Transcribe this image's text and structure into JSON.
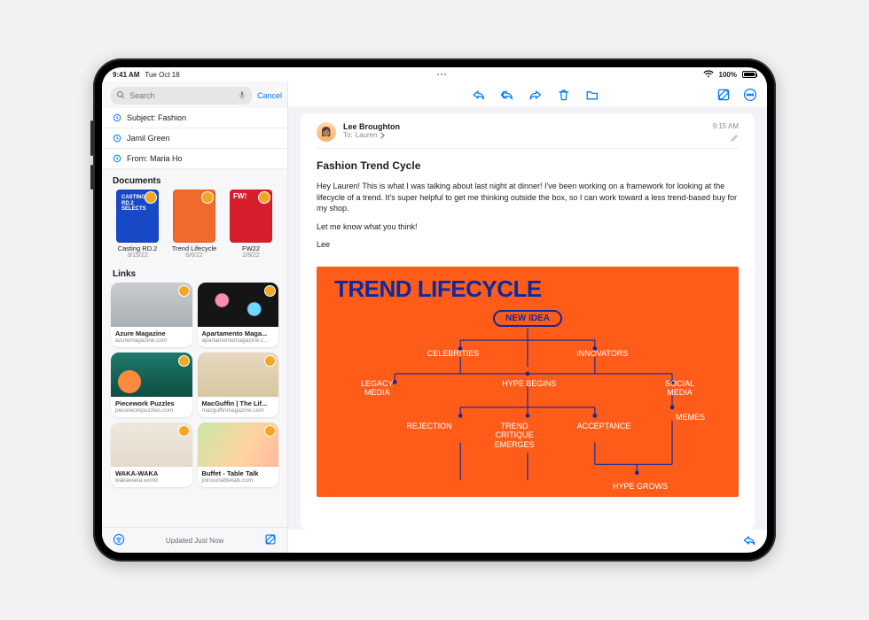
{
  "status": {
    "time": "9:41 AM",
    "date": "Tue Oct 18",
    "battery_label": "100%"
  },
  "sidebar": {
    "search_placeholder": "Search",
    "cancel": "Cancel",
    "filters": [
      {
        "label": "Subject: Fashion"
      },
      {
        "label": "Jamil Green"
      },
      {
        "label": "From: Maria Ho"
      }
    ],
    "documents_title": "Documents",
    "documents": [
      {
        "name": "Casting RD.2",
        "date": "3/15/22",
        "thumb_text": "CASTING\nRD.2\nSELECTS"
      },
      {
        "name": "Trend Lifecycle",
        "date": "6/6/22",
        "thumb_text": ""
      },
      {
        "name": "FW22",
        "date": "2/8/22",
        "thumb_text": "FW!"
      }
    ],
    "links_title": "Links",
    "links": [
      {
        "title": "Azure Magazine",
        "sub": "azuremagazine.com"
      },
      {
        "title": "Apartamento Maga...",
        "sub": "apartamentomagazine.c..."
      },
      {
        "title": "Piecework Puzzles",
        "sub": "pieceworkpuzzles.com"
      },
      {
        "title": "MacGuffin | The Lif...",
        "sub": "macguffinmagazine.com"
      },
      {
        "title": "WAKA-WAKA",
        "sub": "wakawaka.world"
      },
      {
        "title": "Buffet - Table Talk",
        "sub": "joinourtabletalk.com"
      }
    ],
    "footer_status": "Updated Just Now"
  },
  "mail": {
    "sender": "Lee Broughton",
    "to_prefix": "To:",
    "recipient": "Lauren",
    "time": "9:15 AM",
    "subject": "Fashion Trend Cycle",
    "body": [
      "Hey Lauren! This is what I was talking about last night at dinner! I've been working on a framework for looking at the lifecycle of a trend. It's super helpful to get me thinking outside the box, so I can work toward a less trend-based buy for my shop.",
      "Let me know what you think!",
      "Lee"
    ]
  },
  "infographic": {
    "title": "TREND LIFECYCLE",
    "nodes": {
      "new_idea": "NEW IDEA",
      "celebrities": "CELEBRITIES",
      "innovators": "INNOVATORS",
      "legacy_media": "LEGACY\nMEDIA",
      "hype_begins": "HYPE BEGINS",
      "social_media": "SOCIAL\nMEDIA",
      "rejection": "REJECTION",
      "trend_critique": "TREND\nCRITIQUE\nEMERGES",
      "acceptance": "ACCEPTANCE",
      "memes": "MEMES",
      "hype_grows": "HYPE GROWS"
    }
  }
}
